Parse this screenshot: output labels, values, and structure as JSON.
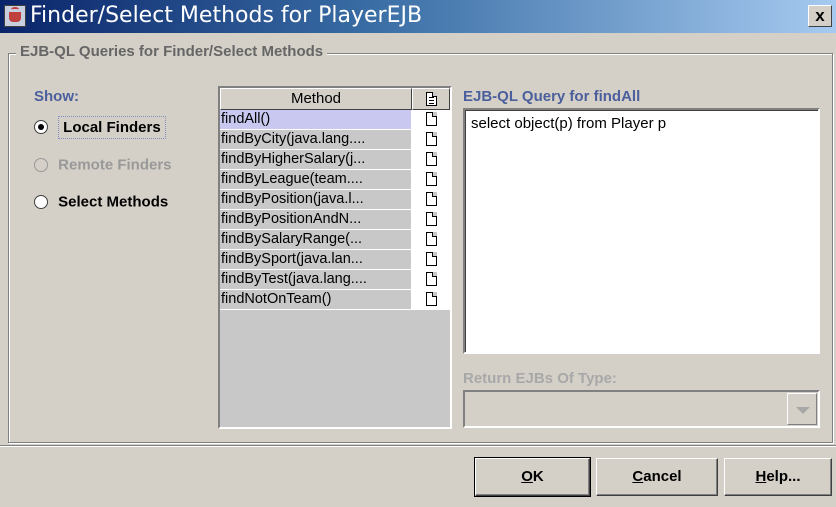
{
  "window": {
    "title": "Finder/Select Methods for PlayerEJB",
    "close_label": "x"
  },
  "group": {
    "legend": "EJB-QL Queries for Finder/Select Methods"
  },
  "show": {
    "label": "Show:",
    "options": [
      {
        "label": "Local Finders",
        "checked": true,
        "enabled": true
      },
      {
        "label": "Remote Finders",
        "checked": false,
        "enabled": false
      },
      {
        "label": "Select Methods",
        "checked": false,
        "enabled": true
      }
    ]
  },
  "methods_table": {
    "column_header": "Method",
    "rows": [
      "findAll()",
      "findByCity(java.lang....",
      "findByHigherSalary(j...",
      "findByLeague(team....",
      "findByPosition(java.l...",
      "findByPositionAndN...",
      "findBySalaryRange(...",
      "findBySport(java.lan...",
      "findByTest(java.lang....",
      "findNotOnTeam()"
    ],
    "selected_index": 0
  },
  "query": {
    "label": "EJB-QL Query for findAll",
    "text": "select object(p) from Player p"
  },
  "return_type": {
    "label": "Return EJBs Of Type:",
    "value": ""
  },
  "buttons": {
    "ok": {
      "mnemonic": "O",
      "rest": "K"
    },
    "cancel": {
      "mnemonic": "C",
      "rest": "ancel"
    },
    "help": {
      "mnemonic": "H",
      "rest": "elp..."
    }
  }
}
